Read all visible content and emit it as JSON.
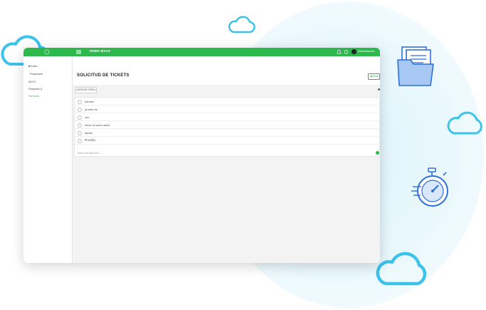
{
  "app": {
    "brand": "HRMS MAXX",
    "user_name": "Administración"
  },
  "sidebar": {
    "items": [
      {
        "label": "Inicio",
        "icon": "home-icon"
      },
      {
        "label": "Proyectos"
      },
      {
        "label": "AVCC"
      },
      {
        "label": "Proyecto jr"
      },
      {
        "label": "Ver todo"
      }
    ]
  },
  "page": {
    "title": "SOLICITUD DE TICKETS",
    "back_label": "Atrás",
    "add_label": "AGREGAR TAREA"
  },
  "tasks": [
    {
      "label": "kanban"
    },
    {
      "label": "prueba de"
    },
    {
      "label": "oso"
    },
    {
      "label": "hacer la tarea diaria"
    },
    {
      "label": "dsfdsf"
    },
    {
      "label": "Prueba"
    }
  ],
  "new_task": {
    "placeholder": "Enter new task here..."
  },
  "colors": {
    "accent": "#2db84b",
    "cloud": "#29b6e0",
    "deco_blue": "#2d6fd9"
  }
}
